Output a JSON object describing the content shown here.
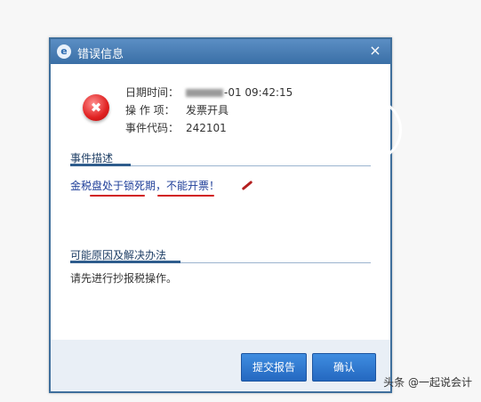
{
  "dialog": {
    "title": "错误信息",
    "close_label": "×"
  },
  "info": {
    "date_label": "日期时间：",
    "date_value": "-01 09:42:15",
    "operation_label": "操 作 项：",
    "operation_value": "发票开具",
    "code_label": "事件代码：",
    "code_value": "242101"
  },
  "event": {
    "heading": "事件描述",
    "description": "金税盘处于锁死期，不能开票！"
  },
  "causes": {
    "heading": "可能原因及解决办法",
    "text": "请先进行抄报税操作。"
  },
  "buttons": {
    "report": "提交报告",
    "confirm": "确认"
  },
  "watermark": "头条 @一起说会计",
  "colors": {
    "title_bar": "#3a6fa6",
    "button": "#2468c0",
    "annotation": "#d11a1a"
  }
}
